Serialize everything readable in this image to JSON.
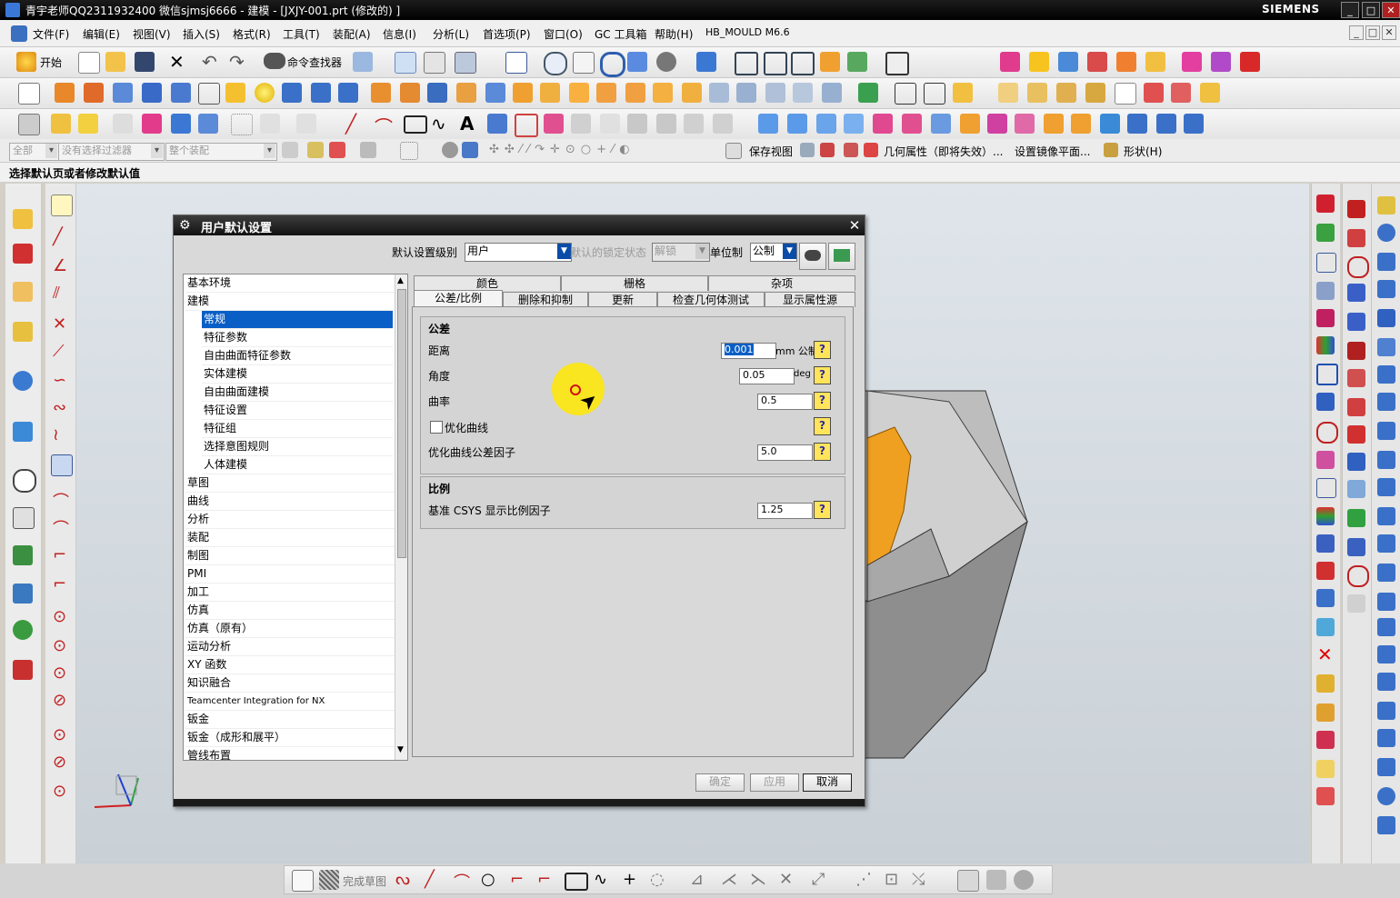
{
  "window": {
    "title": "青宇老师QQ2311932400 微信sjmsj6666 - 建模 - [JXJY-001.prt  (修改的) ]",
    "brand": "SIEMENS"
  },
  "menu": {
    "items": [
      "文件(F)",
      "编辑(E)",
      "视图(V)",
      "插入(S)",
      "格式(R)",
      "工具(T)",
      "装配(A)",
      "信息(I)",
      "分析(L)",
      "首选项(P)",
      "窗口(O)",
      "GC 工具箱",
      "帮助(H)",
      "HB_MOULD M6.6"
    ]
  },
  "toolbar": {
    "start_label": "开始",
    "command_finder": "命令查找器"
  },
  "selection_bar": {
    "filter_all": "全部",
    "no_filter": "没有选择过滤器",
    "whole_assembly": "整个装配",
    "save_view": "保存视图",
    "geometry_props": "几何属性（即将失效）...",
    "mirror_plane": "设置镜像平面...",
    "shape_menu": "形状(H)"
  },
  "cue": "选择默认页或者修改默认值",
  "dialog": {
    "title": "用户默认设置",
    "level_label": "默认设置级别",
    "level_value": "用户",
    "lock_label": "默认的锁定状态",
    "lock_value": "解锁",
    "unit_label": "单位制",
    "unit_value": "公制",
    "tree": [
      {
        "label": "基本环境",
        "sub": false,
        "selected": false
      },
      {
        "label": "建模",
        "sub": false,
        "selected": false
      },
      {
        "label": "常规",
        "sub": true,
        "selected": true
      },
      {
        "label": "特征参数",
        "sub": true,
        "selected": false
      },
      {
        "label": "自由曲面特征参数",
        "sub": true,
        "selected": false
      },
      {
        "label": "实体建模",
        "sub": true,
        "selected": false
      },
      {
        "label": "自由曲面建模",
        "sub": true,
        "selected": false
      },
      {
        "label": "特征设置",
        "sub": true,
        "selected": false
      },
      {
        "label": "特征组",
        "sub": true,
        "selected": false
      },
      {
        "label": "选择意图规则",
        "sub": true,
        "selected": false
      },
      {
        "label": "人体建模",
        "sub": true,
        "selected": false
      },
      {
        "label": "草图",
        "sub": false,
        "selected": false
      },
      {
        "label": "曲线",
        "sub": false,
        "selected": false
      },
      {
        "label": "分析",
        "sub": false,
        "selected": false
      },
      {
        "label": "装配",
        "sub": false,
        "selected": false
      },
      {
        "label": "制图",
        "sub": false,
        "selected": false
      },
      {
        "label": "PMI",
        "sub": false,
        "selected": false
      },
      {
        "label": "加工",
        "sub": false,
        "selected": false
      },
      {
        "label": "仿真",
        "sub": false,
        "selected": false
      },
      {
        "label": "仿真（原有）",
        "sub": false,
        "selected": false
      },
      {
        "label": "运动分析",
        "sub": false,
        "selected": false
      },
      {
        "label": "XY 函数",
        "sub": false,
        "selected": false
      },
      {
        "label": "知识融合",
        "sub": false,
        "selected": false
      },
      {
        "label": "Teamcenter Integration for NX",
        "sub": false,
        "selected": false
      },
      {
        "label": "钣金",
        "sub": false,
        "selected": false
      },
      {
        "label": "钣金（成形和展平）",
        "sub": false,
        "selected": false
      },
      {
        "label": "管线布置",
        "sub": false,
        "selected": false
      }
    ],
    "tabs_row1": [
      "颜色",
      "栅格",
      "杂项"
    ],
    "tabs_row2": [
      "公差/比例",
      "删除和抑制",
      "更新",
      "检查几何体测试",
      "显示属性源"
    ],
    "tolerance": {
      "title": "公差",
      "distance_label": "距离",
      "distance_value": "0.001",
      "distance_unit": "mm 公制",
      "angle_label": "角度",
      "angle_value": "0.05",
      "angle_unit": "deg",
      "curvature_label": "曲率",
      "curvature_value": "0.5",
      "optimize_label": "优化曲线",
      "optimize_factor_label": "优化曲线公差因子",
      "optimize_factor_value": "5.0"
    },
    "scale": {
      "title": "比例",
      "csys_label": "基准 CSYS 显示比例因子",
      "csys_value": "1.25"
    },
    "buttons": {
      "ok": "确定",
      "apply": "应用",
      "cancel": "取消"
    }
  },
  "bottom_toolbar": {
    "finish_sketch": "完成草图"
  },
  "colors": {
    "title_bar": "#000000",
    "selection": "#0a5fc6",
    "help_button": "#ffe45c",
    "model_orange": "#f0a020",
    "viewport": "#d4dbe1"
  }
}
